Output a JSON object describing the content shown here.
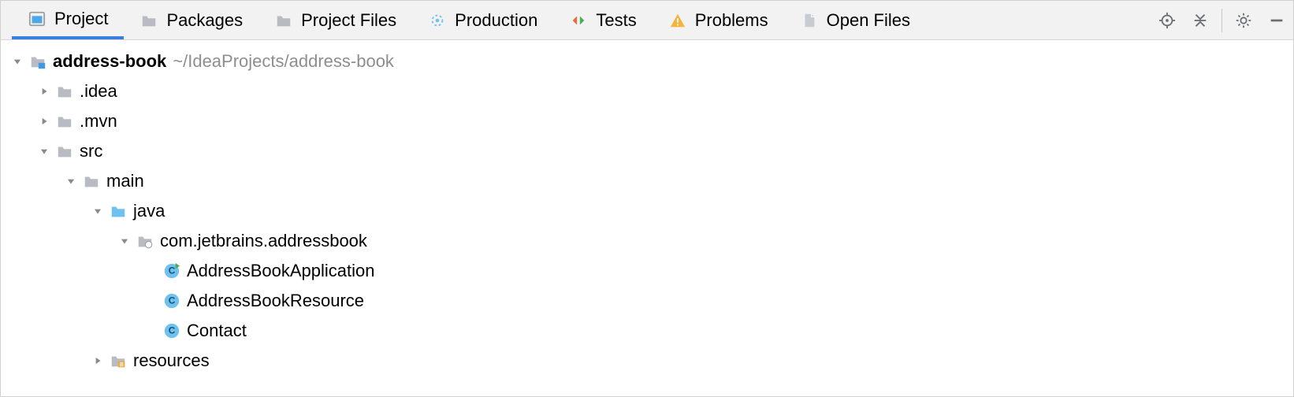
{
  "tabs": [
    {
      "id": "project",
      "label": "Project",
      "icon": "project-window-icon",
      "active": true
    },
    {
      "id": "packages",
      "label": "Packages",
      "icon": "folder-gray-icon"
    },
    {
      "id": "project-files",
      "label": "Project Files",
      "icon": "folder-gray-icon"
    },
    {
      "id": "production",
      "label": "Production",
      "icon": "gear-dashed-icon"
    },
    {
      "id": "tests",
      "label": "Tests",
      "icon": "tests-diff-icon"
    },
    {
      "id": "problems",
      "label": "Problems",
      "icon": "warning-icon"
    },
    {
      "id": "open-files",
      "label": "Open Files",
      "icon": "file-gray-icon"
    }
  ],
  "toolbar_icons": [
    "locate-icon",
    "collapse-all-icon",
    "gear-icon",
    "minimize-icon"
  ],
  "tree": {
    "root": {
      "name": "address-book",
      "path": "~/IdeaProjects/address-book"
    },
    "rows": [
      {
        "depth": 0,
        "arrow": "down",
        "icon": "module-folder-icon",
        "label": "address-book",
        "bold": true,
        "extra": "~/IdeaProjects/address-book"
      },
      {
        "depth": 1,
        "arrow": "right",
        "icon": "folder-gray-icon",
        "label": ".idea"
      },
      {
        "depth": 1,
        "arrow": "right",
        "icon": "folder-gray-icon",
        "label": ".mvn"
      },
      {
        "depth": 1,
        "arrow": "down",
        "icon": "folder-gray-icon",
        "label": "src"
      },
      {
        "depth": 2,
        "arrow": "down",
        "icon": "folder-gray-icon",
        "label": "main"
      },
      {
        "depth": 3,
        "arrow": "down",
        "icon": "source-folder-icon",
        "label": "java"
      },
      {
        "depth": 4,
        "arrow": "down",
        "icon": "package-icon",
        "label": "com.jetbrains.addressbook"
      },
      {
        "depth": 5,
        "arrow": "none",
        "icon": "class-runnable-icon",
        "label": "AddressBookApplication"
      },
      {
        "depth": 5,
        "arrow": "none",
        "icon": "class-icon",
        "label": "AddressBookResource"
      },
      {
        "depth": 5,
        "arrow": "none",
        "icon": "class-icon",
        "label": "Contact"
      },
      {
        "depth": 3,
        "arrow": "right",
        "icon": "resources-folder-icon",
        "label": "resources"
      }
    ]
  }
}
